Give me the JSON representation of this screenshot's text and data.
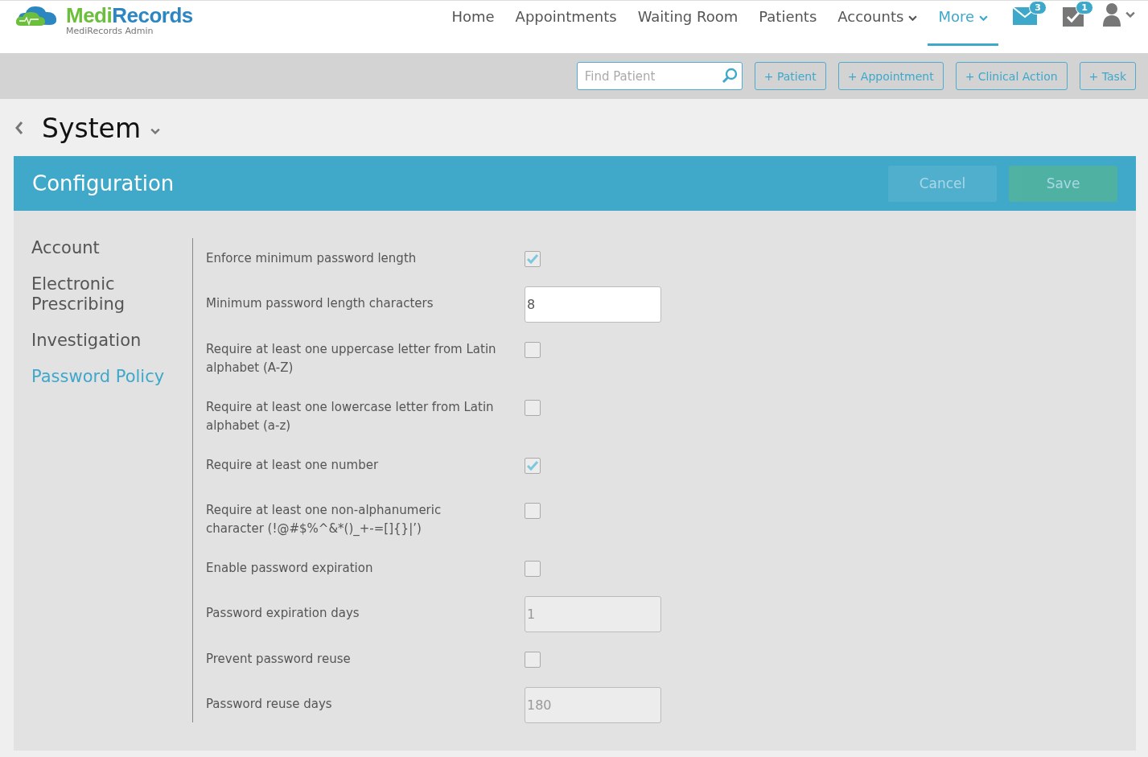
{
  "brand": {
    "name_part_1": "Medi",
    "name_part_2": "Records",
    "subtitle": "MediRecords Admin"
  },
  "nav": [
    {
      "label": "Home",
      "dropdown": false,
      "selected": false
    },
    {
      "label": "Appointments",
      "dropdown": false,
      "selected": false
    },
    {
      "label": "Waiting Room",
      "dropdown": false,
      "selected": false
    },
    {
      "label": "Patients",
      "dropdown": false,
      "selected": false
    },
    {
      "label": "Accounts",
      "dropdown": true,
      "selected": false
    },
    {
      "label": "More",
      "dropdown": true,
      "selected": true
    }
  ],
  "notifications": {
    "messages_badge": "3",
    "tasks_badge": "1"
  },
  "toolbar": {
    "search": {
      "placeholder": "Find Patient"
    },
    "buttons": [
      "+ Patient",
      "+ Appointment",
      "+ Clinical Action",
      "+ Task"
    ]
  },
  "page_title": "System",
  "panel": {
    "title": "Configuration",
    "buttons": [
      {
        "label": "Cancel",
        "kind": "cancel",
        "disabled": true
      },
      {
        "label": "Save",
        "kind": "save",
        "disabled": true
      }
    ]
  },
  "sidebar": {
    "items": [
      {
        "label": "Account",
        "selected": false
      },
      {
        "label": "Electronic Prescribing",
        "selected": false
      },
      {
        "label": "Investigation",
        "selected": false
      },
      {
        "label": "Password Policy",
        "selected": true
      }
    ]
  },
  "settings": [
    {
      "kind": "checkbox",
      "label": "Enforce minimum password length",
      "checked": true
    },
    {
      "kind": "number",
      "label": "Minimum password length characters",
      "value": "8",
      "disabled": false
    },
    {
      "kind": "checkbox",
      "label": "Require at least one uppercase letter from Latin alphabet (A-Z)",
      "checked": false
    },
    {
      "kind": "checkbox",
      "label": "Require at least one lowercase letter from Latin alphabet (a-z)",
      "checked": false
    },
    {
      "kind": "checkbox",
      "label": "Require at least one number",
      "checked": true
    },
    {
      "kind": "checkbox",
      "label": "Require at least one non-alphanumeric character (!@#$%^&*()_+-=[]{}|’)",
      "checked": false
    },
    {
      "kind": "checkbox",
      "label": "Enable password expiration",
      "checked": false
    },
    {
      "kind": "number",
      "label": "Password expiration days",
      "value": "1",
      "disabled": true
    },
    {
      "kind": "checkbox",
      "label": "Prevent password reuse",
      "checked": false
    },
    {
      "kind": "number",
      "label": "Password reuse days",
      "value": "180",
      "disabled": true
    }
  ]
}
